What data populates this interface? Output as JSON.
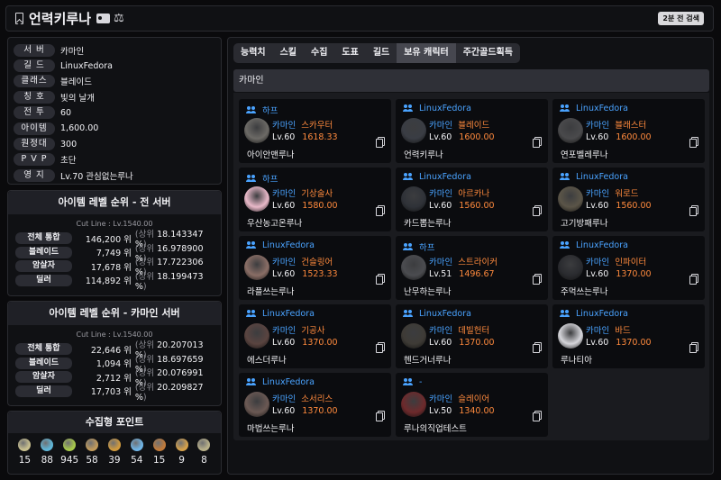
{
  "header": {
    "title": "언력키루나",
    "search_time": "2분 전 검색"
  },
  "info": [
    {
      "label": "서 버",
      "value": "카마인"
    },
    {
      "label": "길 드",
      "value": "LinuxFedora"
    },
    {
      "label": "클래스",
      "value": "블레이드"
    },
    {
      "label": "칭 호",
      "value": "빛의 날개"
    },
    {
      "label": "전 투",
      "value": "60"
    },
    {
      "label": "아이템",
      "value": "1,600.00"
    },
    {
      "label": "원정대",
      "value": "300"
    },
    {
      "label": "P V P",
      "value": "초단"
    },
    {
      "label": "영 지",
      "value": "Lv.70 관심없는루나"
    }
  ],
  "rank_all": {
    "title": "아이템 레벨 순위 - 전 서버",
    "cutline": "Cut Line : Lv.1540.00",
    "rows": [
      {
        "label": "전체 통합",
        "rank": "146,200 위",
        "pct": "18.143347 %"
      },
      {
        "label": "블레이드",
        "rank": "7,749 위",
        "pct": "16.978900 %"
      },
      {
        "label": "암살자",
        "rank": "17,678 위",
        "pct": "17.722306 %"
      },
      {
        "label": "딜러",
        "rank": "114,892 위",
        "pct": "18.199473 %"
      }
    ]
  },
  "rank_server": {
    "title": "아이템 레벨 순위 - 카마인 서버",
    "cutline": "Cut Line : Lv.1540.00",
    "rows": [
      {
        "label": "전체 통합",
        "rank": "22,646 위",
        "pct": "20.207013 %"
      },
      {
        "label": "블레이드",
        "rank": "1,094 위",
        "pct": "18.697659 %"
      },
      {
        "label": "암살자",
        "rank": "2,712 위",
        "pct": "20.076991 %"
      },
      {
        "label": "딜러",
        "rank": "17,703 위",
        "pct": "20.209827 %"
      }
    ]
  },
  "labels": {
    "upper": "(상위",
    "close_paren": ")"
  },
  "collect": {
    "title": "수집형 포인트",
    "items": [
      {
        "icon": "mokoko-icon",
        "count": "15",
        "color": "#c9c08f"
      },
      {
        "icon": "island-heart-icon",
        "count": "88",
        "color": "#5fb6d8"
      },
      {
        "icon": "mokoko-seed-icon",
        "count": "945",
        "color": "#a7c94a"
      },
      {
        "icon": "art-icon",
        "count": "58",
        "color": "#c19a5b"
      },
      {
        "icon": "adventure-book-icon",
        "count": "39",
        "color": "#d09a3e"
      },
      {
        "icon": "voyage-icon",
        "count": "54",
        "color": "#6fb4e6"
      },
      {
        "icon": "world-tree-leaf-icon",
        "count": "15",
        "color": "#c07a3a"
      },
      {
        "icon": "orpheus-star-icon",
        "count": "9",
        "color": "#d5a04a"
      },
      {
        "icon": "giant-heart-icon",
        "count": "8",
        "color": "#b8b089"
      }
    ]
  },
  "tabs": [
    {
      "label": "능력치",
      "active": false
    },
    {
      "label": "스킬",
      "active": false
    },
    {
      "label": "수집",
      "active": false
    },
    {
      "label": "도표",
      "active": false
    },
    {
      "label": "길드",
      "active": false
    },
    {
      "label": "보유 캐릭터",
      "active": true
    },
    {
      "label": "주간골드획득",
      "active": false
    }
  ],
  "section": {
    "server_name": "카마인"
  },
  "characters": [
    {
      "guild": "하프",
      "region": "카마인",
      "cls": "스카우터",
      "lv": "Lv.60",
      "il": "1618.33",
      "name": "아이안맨루나",
      "avatar": "#6c6a66"
    },
    {
      "guild": "LinuxFedora",
      "region": "카마인",
      "cls": "블레이드",
      "lv": "Lv.60",
      "il": "1600.00",
      "name": "언력키루나",
      "avatar": "#3a3d44"
    },
    {
      "guild": "LinuxFedora",
      "region": "카마인",
      "cls": "블래스터",
      "lv": "Lv.60",
      "il": "1600.00",
      "name": "연포벨레루나",
      "avatar": "#4a4a4c"
    },
    {
      "guild": "하프",
      "region": "카마인",
      "cls": "기상술사",
      "lv": "Lv.60",
      "il": "1580.00",
      "name": "우산농고온루나",
      "avatar": "#e9b9c9"
    },
    {
      "guild": "LinuxFedora",
      "region": "카마인",
      "cls": "아르카나",
      "lv": "Lv.60",
      "il": "1560.00",
      "name": "카드뽑는루나",
      "avatar": "#2f3238"
    },
    {
      "guild": "LinuxFedora",
      "region": "카마인",
      "cls": "워로드",
      "lv": "Lv.60",
      "il": "1560.00",
      "name": "고기방패루나",
      "avatar": "#5b5548"
    },
    {
      "guild": "LinuxFedora",
      "region": "카마인",
      "cls": "건슬링어",
      "lv": "Lv.60",
      "il": "1523.33",
      "name": "라플쓰는루나",
      "avatar": "#8a6e66"
    },
    {
      "guild": "하프",
      "region": "카마인",
      "cls": "스트라이커",
      "lv": "Lv.51",
      "il": "1496.67",
      "name": "난무하는루나",
      "avatar": "#4b4c50"
    },
    {
      "guild": "LinuxFedora",
      "region": "카마인",
      "cls": "인파이터",
      "lv": "Lv.60",
      "il": "1370.00",
      "name": "주먹쓰는루나",
      "avatar": "#2a2b2f"
    },
    {
      "guild": "LinuxFedora",
      "region": "카마인",
      "cls": "기공사",
      "lv": "Lv.60",
      "il": "1370.00",
      "name": "에스더루나",
      "avatar": "#5a4440"
    },
    {
      "guild": "LinuxFedora",
      "region": "카마인",
      "cls": "데빌헌터",
      "lv": "Lv.60",
      "il": "1370.00",
      "name": "헨드거너루나",
      "avatar": "#3e3b36"
    },
    {
      "guild": "LinuxFedora",
      "region": "카마인",
      "cls": "바드",
      "lv": "Lv.60",
      "il": "1370.00",
      "name": "루나티아",
      "avatar": "#d6d6db"
    },
    {
      "guild": "LinuxFedora",
      "region": "카마인",
      "cls": "소서리스",
      "lv": "Lv.60",
      "il": "1370.00",
      "name": "마법쓰는루나",
      "avatar": "#6b5954"
    },
    {
      "guild": "-",
      "region": "카마인",
      "cls": "슬레이어",
      "lv": "Lv.50",
      "il": "1340.00",
      "name": "루나의직업테스트",
      "avatar": "#6e2a2c"
    }
  ]
}
